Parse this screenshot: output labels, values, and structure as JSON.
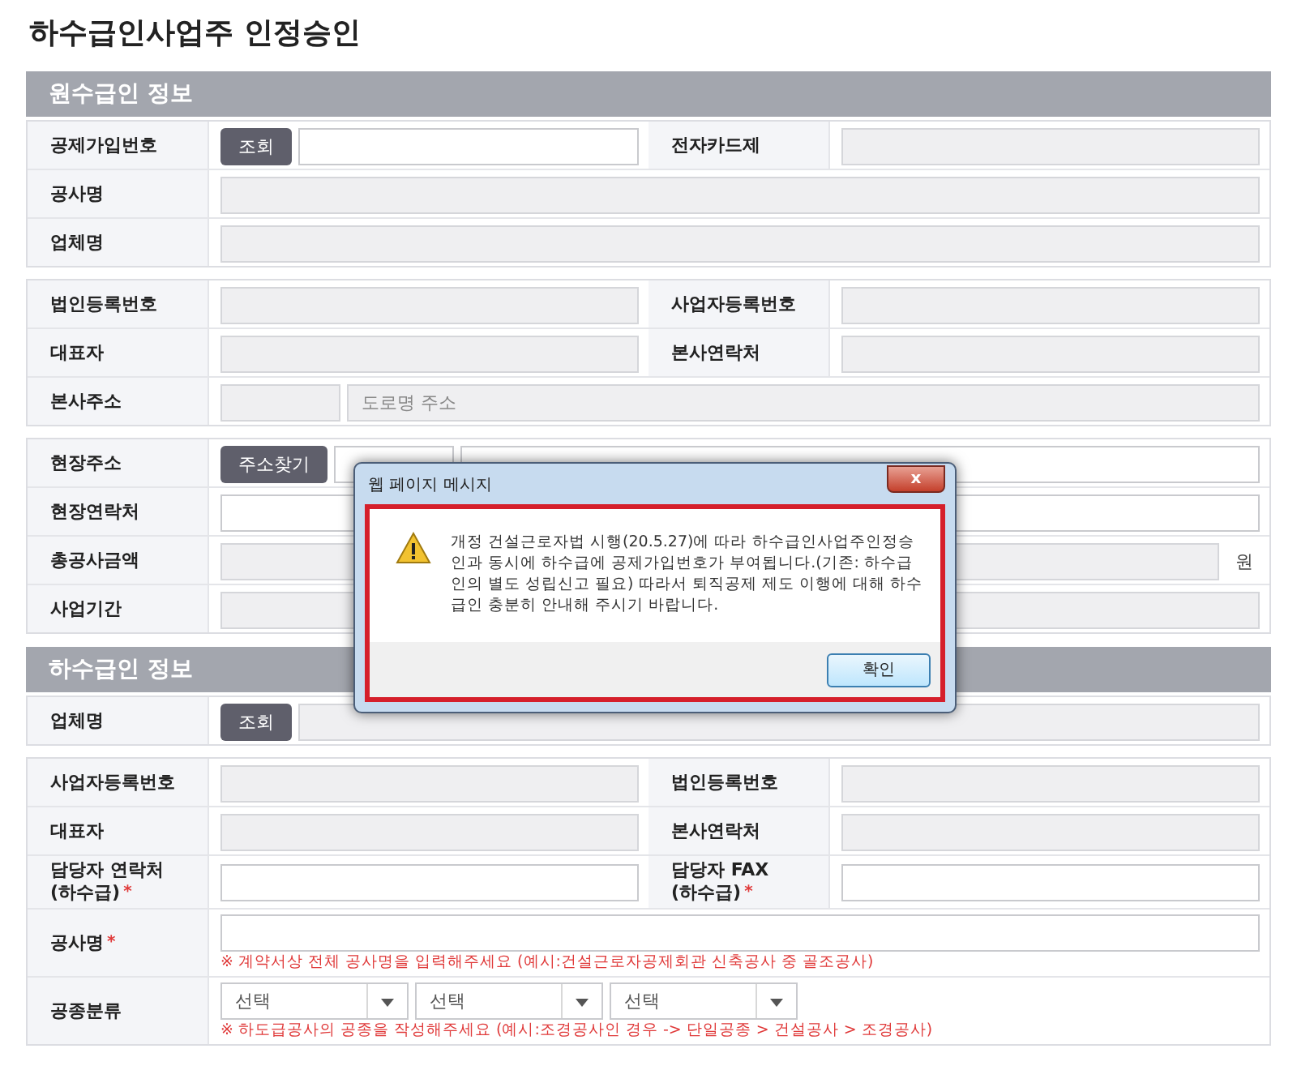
{
  "page_title": "하수급인사업주 인정승인",
  "sections": [
    {
      "title": "원수급인 정보",
      "tables": [
        {
          "rows": [
            [
              {
                "label": "공제가입번호",
                "parts": [
                  {
                    "kind": "button",
                    "text": "조회"
                  },
                  {
                    "kind": "input",
                    "readonly": false
                  }
                ]
              },
              {
                "label": "전자카드제",
                "parts": [
                  {
                    "kind": "input",
                    "readonly": true
                  }
                ]
              }
            ],
            [
              {
                "label": "공사명",
                "parts": [
                  {
                    "kind": "input",
                    "readonly": true
                  }
                ]
              }
            ],
            [
              {
                "label": "업체명",
                "parts": [
                  {
                    "kind": "input",
                    "readonly": true
                  }
                ]
              }
            ]
          ]
        },
        {
          "rows": [
            [
              {
                "label": "법인등록번호",
                "parts": [
                  {
                    "kind": "input",
                    "readonly": true
                  }
                ]
              },
              {
                "label": "사업자등록번호",
                "parts": [
                  {
                    "kind": "input",
                    "readonly": true
                  }
                ]
              }
            ],
            [
              {
                "label": "대표자",
                "parts": [
                  {
                    "kind": "input",
                    "readonly": true
                  }
                ]
              },
              {
                "label": "본사연락처",
                "parts": [
                  {
                    "kind": "input",
                    "readonly": true
                  }
                ]
              }
            ],
            [
              {
                "label": "본사주소",
                "parts": [
                  {
                    "kind": "short_input",
                    "readonly": true
                  },
                  {
                    "kind": "input",
                    "readonly": true,
                    "placeholder": "도로명 주소"
                  }
                ]
              }
            ]
          ]
        },
        {
          "rows": [
            [
              {
                "label": "현장주소",
                "parts": [
                  {
                    "kind": "button",
                    "text": "주소찾기"
                  },
                  {
                    "kind": "short_input",
                    "readonly": false
                  },
                  {
                    "kind": "input",
                    "readonly": false
                  }
                ]
              }
            ],
            [
              {
                "label": "현장연락처",
                "parts": [
                  {
                    "kind": "input",
                    "readonly": false
                  }
                ]
              }
            ],
            [
              {
                "label": "총공사금액",
                "parts": [
                  {
                    "kind": "input",
                    "readonly": true
                  },
                  {
                    "kind": "unit",
                    "text": "원"
                  }
                ]
              }
            ],
            [
              {
                "label": "사업기간",
                "parts": [
                  {
                    "kind": "input",
                    "readonly": true
                  }
                ]
              }
            ]
          ]
        }
      ]
    },
    {
      "title": "하수급인 정보",
      "tables": [
        {
          "rows": [
            [
              {
                "label": "업체명",
                "parts": [
                  {
                    "kind": "button",
                    "text": "조회"
                  },
                  {
                    "kind": "input",
                    "readonly": true
                  }
                ]
              }
            ]
          ]
        },
        {
          "rows": [
            [
              {
                "label": "사업자등록번호",
                "parts": [
                  {
                    "kind": "input",
                    "readonly": true
                  }
                ]
              },
              {
                "label": "법인등록번호",
                "parts": [
                  {
                    "kind": "input",
                    "readonly": true
                  }
                ]
              }
            ],
            [
              {
                "label": "대표자",
                "parts": [
                  {
                    "kind": "input",
                    "readonly": true
                  }
                ]
              },
              {
                "label": "본사연락처",
                "parts": [
                  {
                    "kind": "input",
                    "readonly": true
                  }
                ]
              }
            ],
            [
              {
                "label": "담당자 연락처",
                "label2": "(하수급)",
                "mark": "*",
                "parts": [
                  {
                    "kind": "input",
                    "readonly": false
                  }
                ]
              },
              {
                "label": "담당자 FAX",
                "label2": "(하수급)",
                "mark": "*",
                "parts": [
                  {
                    "kind": "input",
                    "readonly": false
                  }
                ]
              }
            ],
            [
              {
                "label": "공사명",
                "mark": "*",
                "parts": [
                  {
                    "kind": "input",
                    "readonly": false
                  }
                ],
                "note": "※ 계약서상 전체 공사명을 입력해주세요 (예시:건설근로자공제회관 신축공사 중 골조공사)"
              }
            ],
            [
              {
                "label": "공종분류",
                "parts": [
                  {
                    "kind": "select",
                    "text": "선택"
                  },
                  {
                    "kind": "select",
                    "text": "선택"
                  },
                  {
                    "kind": "select",
                    "text": "선택"
                  }
                ],
                "note": "※ 하도급공사의 공종을 작성해주세요 (예시:조경공사인 경우 -> 단일공종 > 건설공사 > 조경공사)"
              }
            ]
          ]
        }
      ]
    }
  ],
  "dialog": {
    "title": "웹 페이지 메시지",
    "close": "x",
    "message": "개정 건설근로자법 시행(20.5.27)에 따라 하수급인사업주인정승인과 동시에 하수급에 공제가입번호가 부여됩니다.(기존: 하수급인의 별도 성립신고 필요) 따라서 퇴직공제 제도 이행에 대해 하수급인 충분히 안내해 주시기 바랍니다.",
    "button": "확인"
  }
}
